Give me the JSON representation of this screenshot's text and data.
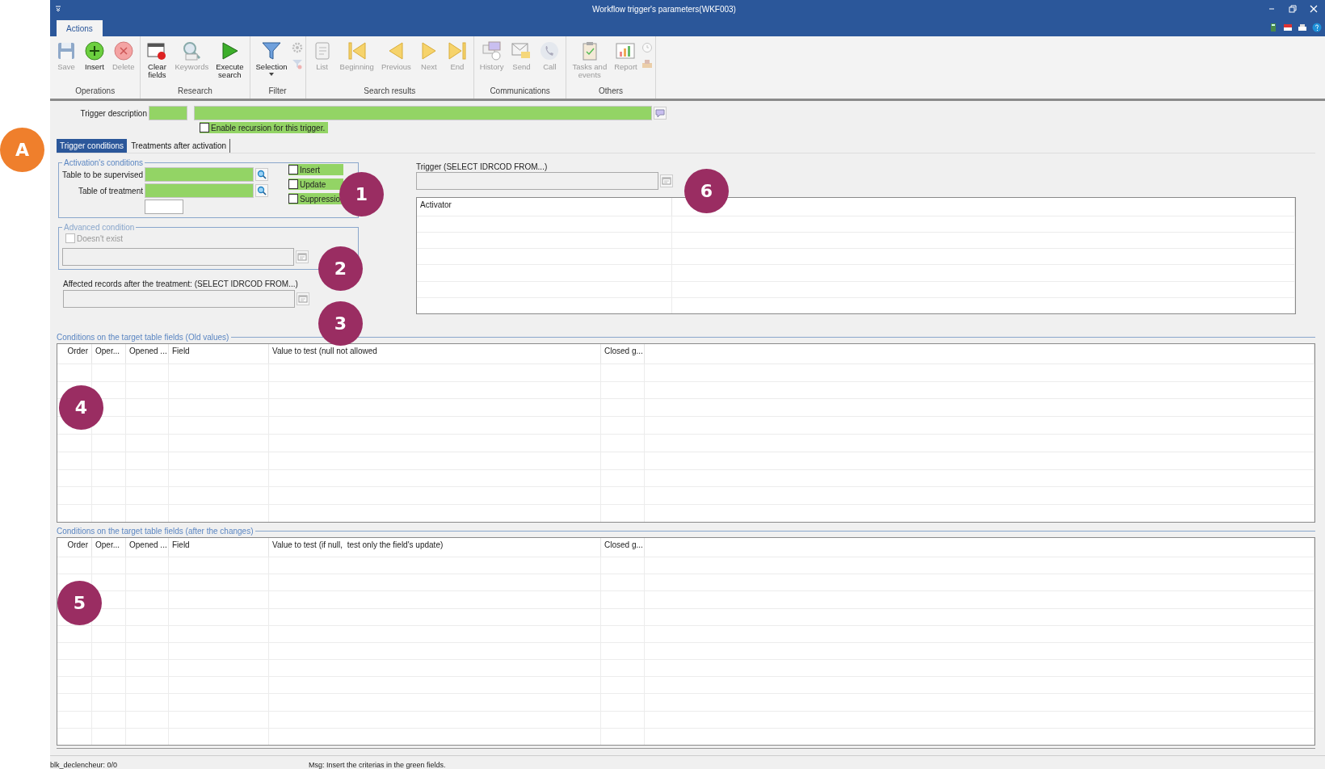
{
  "window": {
    "title": "Workflow trigger's parameters(WKF003)"
  },
  "ribbon_tabs": [
    {
      "label": "Actions",
      "selected": true
    }
  ],
  "ribbon_groups": [
    {
      "label": "Operations",
      "buttons": [
        {
          "kind": "save",
          "label": "Save",
          "disabled": true
        },
        {
          "kind": "insert",
          "label": "Insert",
          "disabled": false
        },
        {
          "kind": "delete",
          "label": "Delete",
          "disabled": true
        }
      ]
    },
    {
      "label": "Research",
      "buttons": [
        {
          "kind": "clear",
          "label": "Clear\nfields",
          "disabled": false
        },
        {
          "kind": "keywords",
          "label": "Keywords",
          "disabled": true
        },
        {
          "kind": "execute",
          "label": "Execute\nsearch",
          "disabled": false
        }
      ]
    },
    {
      "label": "Filter",
      "buttons": [
        {
          "kind": "selection",
          "label": "Selection",
          "disabled": false,
          "dropdown": true
        }
      ],
      "side_icons": [
        {
          "kind": "gear",
          "disabled": true
        },
        {
          "kind": "filter",
          "disabled": true
        }
      ]
    },
    {
      "label": "Search results",
      "buttons": [
        {
          "kind": "list",
          "label": "List",
          "disabled": true
        },
        {
          "kind": "beginning",
          "label": "Beginning",
          "disabled": true
        },
        {
          "kind": "previous",
          "label": "Previous",
          "disabled": true
        },
        {
          "kind": "next",
          "label": "Next",
          "disabled": true
        },
        {
          "kind": "end",
          "label": "End",
          "disabled": true
        }
      ]
    },
    {
      "label": "Communications",
      "buttons": [
        {
          "kind": "history",
          "label": "History",
          "disabled": true
        },
        {
          "kind": "send",
          "label": "Send",
          "disabled": true
        },
        {
          "kind": "call",
          "label": "Call",
          "disabled": true
        }
      ]
    },
    {
      "label": "Others",
      "buttons": [
        {
          "kind": "tasks",
          "label": "Tasks and\nevents",
          "disabled": true
        },
        {
          "kind": "report",
          "label": "Report",
          "disabled": true
        }
      ],
      "side_icons": [
        {
          "kind": "clock",
          "disabled": true
        },
        {
          "kind": "tray",
          "disabled": true
        }
      ]
    }
  ],
  "trigger_description": {
    "label": "Trigger description",
    "code_field": {
      "required": true
    },
    "text_field": {
      "required": true
    }
  },
  "recursion": {
    "label": "Enable recursion for this trigger.",
    "checked": false,
    "required": true
  },
  "tabs": [
    {
      "label": "Trigger conditions",
      "selected": true
    },
    {
      "label": "Treatments after activation",
      "selected": false
    }
  ],
  "activation": {
    "legend": "Activation's conditions",
    "fields": [
      {
        "label": "Table to be supervised",
        "required": true
      },
      {
        "label": "Table of treatment",
        "required": true
      }
    ],
    "options": [
      {
        "label": "Insert",
        "checked": false,
        "required": true
      },
      {
        "label": "Update",
        "checked": false,
        "required": true
      },
      {
        "label": "Suppressio",
        "checked": false,
        "required": true
      }
    ]
  },
  "advanced": {
    "legend": "Advanced condition",
    "option": {
      "label": "Doesn't exist",
      "checked": false,
      "disabled": true
    }
  },
  "affected": {
    "label": "Affected records after the treatment: (SELECT IDRCOD FROM...)"
  },
  "trigger_query": {
    "label": "Trigger (SELECT IDRCOD FROM...)"
  },
  "activator_table": {
    "columns": [
      "Activator"
    ]
  },
  "old_conditions": {
    "title": "Conditions on the target table fields (Old values)",
    "columns": [
      "Order",
      "Oper...",
      "Opened ...",
      "Field",
      "Value to test (null not allowed",
      "Closed g..."
    ]
  },
  "new_conditions": {
    "title": "Conditions on the target table fields (after the changes)",
    "columns": [
      "Order",
      "Oper...",
      "Opened ...",
      "Field",
      "Value to test (if null,  test only the field's update)",
      "Closed g..."
    ]
  },
  "status_bar": [
    "blk_declencheur: 0/0",
    "Msg: Insert the criterias in the green fields."
  ],
  "callouts": [
    {
      "label": "A",
      "color": "#ef7f2c"
    },
    {
      "label": "1",
      "color": "#9a2d62"
    },
    {
      "label": "2",
      "color": "#9a2d62"
    },
    {
      "label": "3",
      "color": "#9a2d62"
    },
    {
      "label": "4",
      "color": "#9a2d62"
    },
    {
      "label": "5",
      "color": "#9a2d62"
    },
    {
      "label": "6",
      "color": "#9a2d62"
    }
  ]
}
